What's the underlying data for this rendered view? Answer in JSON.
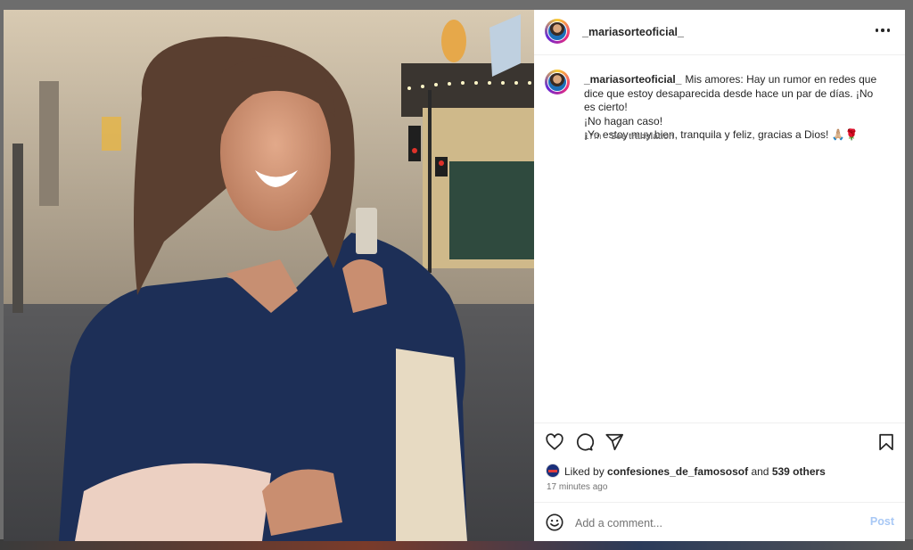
{
  "post": {
    "username": "_mariasorteoficial_",
    "caption_lines": [
      "Mis amores: Hay un rumor en redes que dice que estoy desaparecida desde hace un par de días. ¡No es cierto!",
      "¡No hagan caso!",
      "¡Yo estoy muy bien, tranquila y feliz, gracias a Dios! 🙏🏼🌹"
    ],
    "caption_age": "17m",
    "see_translation": "See translation",
    "liked_by_prefix": "Liked by",
    "liked_by_user": "confesiones_de_famososof",
    "liked_by_and": "and",
    "liked_by_others": "539 others",
    "time_ago": "17 minutes ago"
  },
  "comment": {
    "placeholder": "Add a comment...",
    "post_label": "Post"
  },
  "icons": {
    "more": "more-options-icon",
    "like": "heart-icon",
    "comment": "comment-bubble-icon",
    "share": "paper-plane-icon",
    "save": "bookmark-icon",
    "emoji": "smiley-icon"
  },
  "colors": {
    "text": "#262626",
    "muted": "#737373",
    "post_button_disabled": "#a8c8f5",
    "divider": "#efefef"
  }
}
